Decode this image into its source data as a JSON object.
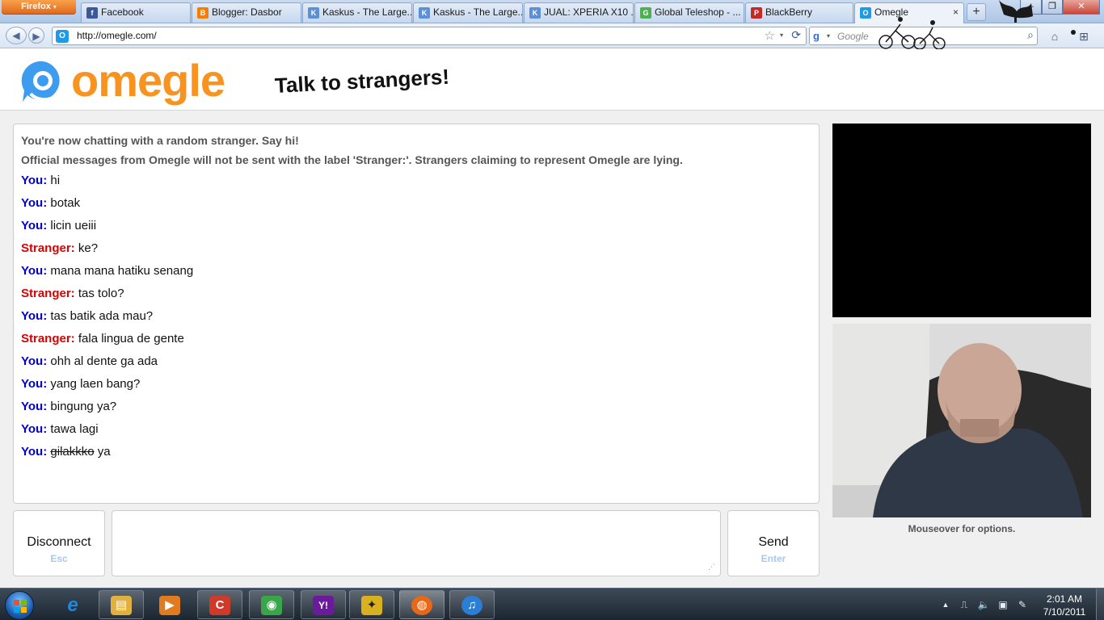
{
  "browser": {
    "menu_button": "Firefox",
    "tabs": [
      {
        "label": "Facebook",
        "favicon": "f",
        "color": "#3b5998"
      },
      {
        "label": "Blogger: Dasbor",
        "favicon": "B",
        "color": "#f57d00"
      },
      {
        "label": "Kaskus - The Large...",
        "favicon": "K",
        "color": "#5b8fd6"
      },
      {
        "label": "Kaskus - The Large...",
        "favicon": "K",
        "color": "#5b8fd6"
      },
      {
        "label": "JUAL: XPERIA X10 ...",
        "favicon": "K",
        "color": "#5b8fd6"
      },
      {
        "label": "Global Teleshop - ...",
        "favicon": "G",
        "color": "#4caf50"
      },
      {
        "label": "BlackBerry",
        "favicon": "P",
        "color": "#c62828"
      },
      {
        "label": "Omegle",
        "favicon": "O",
        "color": "#1e9be8"
      }
    ],
    "new_tab_glyph": "+",
    "close_tab_glyph": "×",
    "window_controls": [
      "–",
      "❐",
      "✕"
    ],
    "back_glyph": "◀",
    "forward_glyph": "▶",
    "url": "http://omegle.com/",
    "star_glyph": "☆",
    "dropdown_glyph": "▾",
    "reload_glyph": "⟳",
    "search_engine_glyph": "g",
    "search_placeholder": "Google",
    "search_glyph": "⌕",
    "home_glyph": "⌂",
    "addon_glyph": "⊞",
    "accent": "#aec6e6"
  },
  "header": {
    "logo_text": "omegle",
    "tagline": "Talk to strangers!",
    "logo_color": "#f7931e",
    "logo_icon_color": "#3d9bf0"
  },
  "chat": {
    "status_lines": [
      "You're now chatting with a random stranger. Say hi!",
      "Official messages from Omegle will not be sent with the label 'Stranger:'. Strangers claiming to represent Omegle are lying."
    ],
    "messages": [
      {
        "who": "You:",
        "role": "you",
        "text": "hi"
      },
      {
        "who": "You:",
        "role": "you",
        "text": "botak"
      },
      {
        "who": "You:",
        "role": "you",
        "text": "licin ueiii"
      },
      {
        "who": "Stranger:",
        "role": "stranger",
        "text": "ke?"
      },
      {
        "who": "You:",
        "role": "you",
        "text": "mana mana hatiku senang"
      },
      {
        "who": "Stranger:",
        "role": "stranger",
        "text": "tas tolo?"
      },
      {
        "who": "You:",
        "role": "you",
        "text": "tas batik ada mau?"
      },
      {
        "who": "Stranger:",
        "role": "stranger",
        "text": "fala lingua de gente"
      },
      {
        "who": "You:",
        "role": "you",
        "text": "ohh al dente ga ada"
      },
      {
        "who": "You:",
        "role": "you",
        "text": "yang laen bang?"
      },
      {
        "who": "You:",
        "role": "you",
        "text": "bingung ya?"
      },
      {
        "who": "You:",
        "role": "you",
        "text": "tawa lagi"
      },
      {
        "who": "You:",
        "role": "you",
        "strike": "gilakkko",
        "text": " ya"
      }
    ],
    "you_color": "#0000cc",
    "stranger_color": "#dd0000"
  },
  "controls": {
    "disconnect_label": "Disconnect",
    "disconnect_hint": "Esc",
    "send_label": "Send",
    "send_hint": "Enter",
    "message_value": "",
    "resize_glyph": "⋰"
  },
  "video": {
    "hint": "Mouseover for options."
  },
  "taskbar": {
    "apps": [
      {
        "name": "internet-explorer",
        "glyph": "e",
        "color": "#1e88e5",
        "open": false
      },
      {
        "name": "windows-explorer",
        "glyph": "▤",
        "color": "#e0b040",
        "open": true
      },
      {
        "name": "media-player",
        "glyph": "▶",
        "color": "#e07b20",
        "open": true
      },
      {
        "name": "ccleaner",
        "glyph": "C",
        "color": "#d03a2a",
        "open": true
      },
      {
        "name": "internet-download-manager",
        "glyph": "◉",
        "color": "#3aa64a",
        "open": true
      },
      {
        "name": "yahoo-messenger",
        "glyph": "Y!",
        "color": "#6a1b9a",
        "open": true
      },
      {
        "name": "bird-app",
        "glyph": "✦",
        "color": "#d8b020",
        "open": true
      },
      {
        "name": "firefox",
        "glyph": "◍",
        "color": "#e8681a",
        "open": true
      },
      {
        "name": "itunes",
        "glyph": "♫",
        "color": "#2a7fd4",
        "open": true
      }
    ],
    "tray_glyphs": [
      "▲",
      "⎍",
      "🔈",
      "▣",
      "✎"
    ],
    "time": "2:01 AM",
    "date": "7/10/2011"
  }
}
